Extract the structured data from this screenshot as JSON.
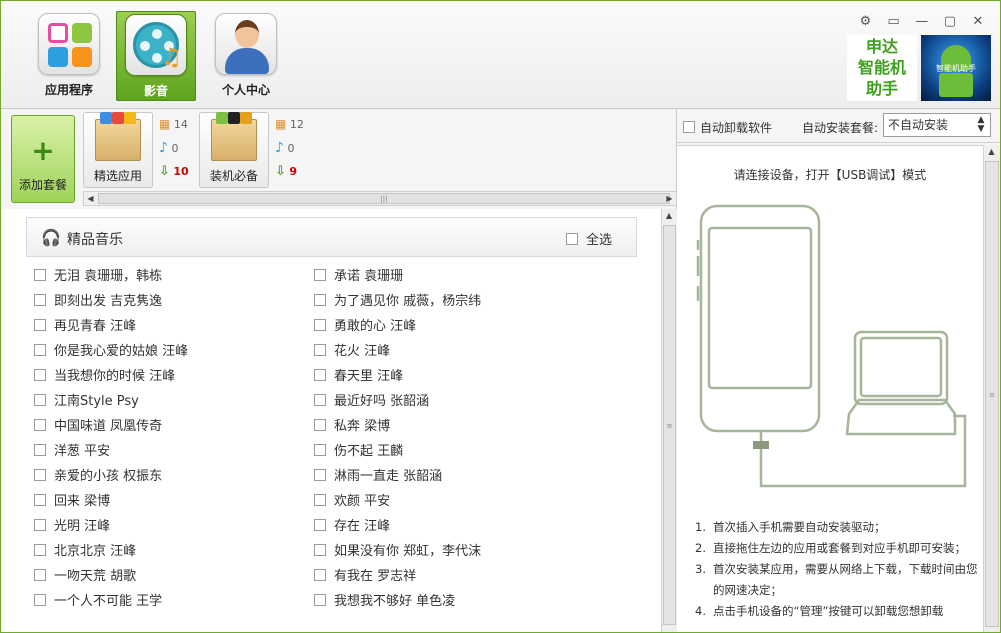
{
  "nav": {
    "tabs": [
      {
        "label": "应用程序",
        "icon": "app-grid-icon"
      },
      {
        "label": "影音",
        "icon": "media-icon",
        "active": true
      },
      {
        "label": "个人中心",
        "icon": "user-avatar-icon"
      }
    ]
  },
  "brand": {
    "line1": "申达",
    "line2": "智能机",
    "line3": "助手",
    "image_text": "智能机助手"
  },
  "window_controls": {
    "settings": "⚙",
    "feedback": "▭",
    "minimize": "—",
    "maximize": "▢",
    "close": "✕"
  },
  "packages": {
    "add_label": "添加套餐",
    "add_symbol": "+",
    "items": [
      {
        "label": "精选应用",
        "apps": "14",
        "music": "0",
        "downloads": "10"
      },
      {
        "label": "装机必备",
        "apps": "12",
        "music": "0",
        "downloads": "9"
      }
    ]
  },
  "section": {
    "title": "精品音乐",
    "select_all": "全选"
  },
  "songs": {
    "left": [
      "无泪 袁珊珊，韩栋",
      "即刻出发 吉克隽逸",
      "再见青春 汪峰",
      "你是我心爱的姑娘 汪峰",
      "当我想你的时候 汪峰",
      "江南Style Psy",
      "中国味道 凤凰传奇",
      "洋葱 平安",
      "亲爱的小孩 权振东",
      "回来 梁博",
      "光明 汪峰",
      "北京北京 汪峰",
      "一吻天荒 胡歌",
      "一个人不可能 王学"
    ],
    "right": [
      "承诺 袁珊珊",
      "为了遇见你 戚薇，杨宗纬",
      "勇敢的心 汪峰",
      "花火 汪峰",
      "春天里 汪峰",
      "最近好吗 张韶涵",
      "私奔 梁博",
      "伤不起 王麟",
      "淋雨一直走 张韶涵",
      "欢颜 平安",
      "存在 汪峰",
      "如果没有你 郑虹，李代沫",
      "有我在 罗志祥",
      "我想我不够好 单色凌"
    ]
  },
  "right_panel": {
    "auto_uninstall": "自动卸载软件",
    "auto_install_label": "自动安装套餐:",
    "auto_install_value": "不自动安装",
    "connect_text": "请连接设备，打开【USB调试】模式",
    "instructions": [
      {
        "num": "1.",
        "text": "首次插入手机需要自动安装驱动；"
      },
      {
        "num": "2.",
        "text": "直接拖住左边的应用或套餐到对应手机即可安装；"
      },
      {
        "num": "3.",
        "text": "首次安装某应用，需要从网络上下载，下载时间由您的网速决定；"
      },
      {
        "num": "4.",
        "text": "点击手机设备的“管理”按键可以卸载您想卸载"
      }
    ]
  },
  "colors": {
    "accent": "#5ea41d",
    "brand_text": "#3fa01e",
    "device_outline": "#a7b59b"
  }
}
